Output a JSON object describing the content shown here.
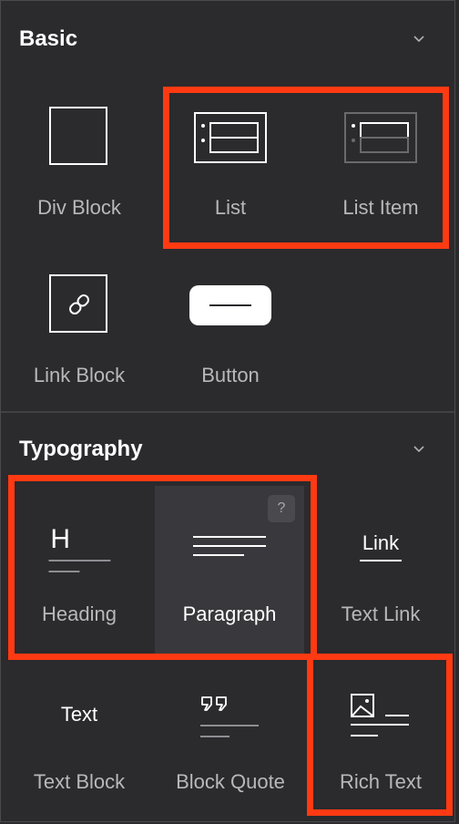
{
  "sections": [
    {
      "title": "Basic",
      "collapse_icon": "chevron-down-icon",
      "items": [
        {
          "label": "Div Block",
          "icon": "div-block-icon"
        },
        {
          "label": "List",
          "icon": "list-icon"
        },
        {
          "label": "List Item",
          "icon": "list-item-icon"
        },
        {
          "label": "Link Block",
          "icon": "link-block-icon"
        },
        {
          "label": "Button",
          "icon": "button-icon"
        }
      ]
    },
    {
      "title": "Typography",
      "collapse_icon": "chevron-down-icon",
      "items": [
        {
          "label": "Heading",
          "icon": "heading-icon",
          "glyph": "H"
        },
        {
          "label": "Paragraph",
          "icon": "paragraph-icon",
          "help": "?"
        },
        {
          "label": "Text Link",
          "icon": "text-link-icon",
          "glyph": "Link"
        },
        {
          "label": "Text Block",
          "icon": "text-block-icon",
          "glyph": "Text"
        },
        {
          "label": "Block Quote",
          "icon": "block-quote-icon"
        },
        {
          "label": "Rich Text",
          "icon": "rich-text-icon"
        }
      ]
    }
  ],
  "colors": {
    "background": "#2b2a2d",
    "hover_tile": "#39383c",
    "highlight": "#ff3a12",
    "label": "#b8b8bb",
    "title": "#ffffff"
  }
}
